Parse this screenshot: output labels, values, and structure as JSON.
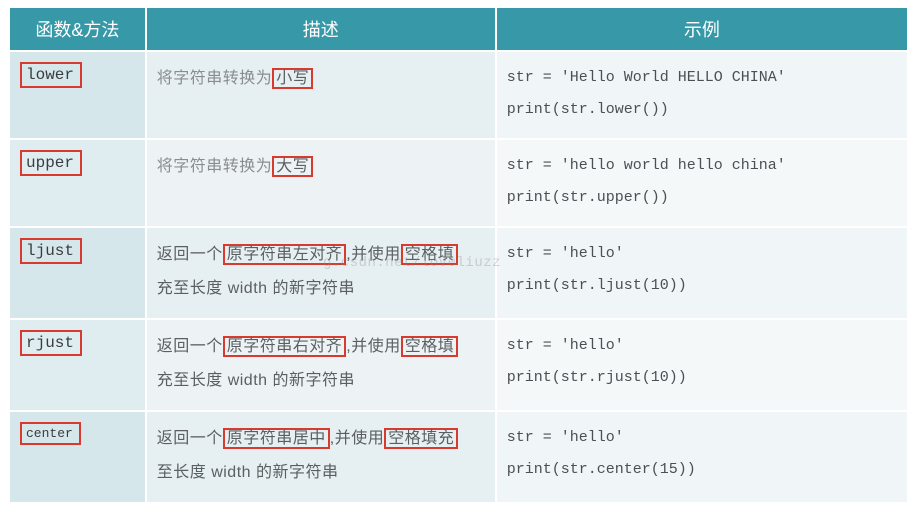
{
  "headers": {
    "col1": "函数&方法",
    "col2": "描述",
    "col3": "示例"
  },
  "rows": [
    {
      "fn": "lower",
      "fn_small": false,
      "desc_pre": "将字符串转换为",
      "desc_hl1": "小写",
      "desc_mid": "",
      "desc_hl2": "",
      "desc_post": "",
      "desc_line2": "",
      "desc_greyish": true,
      "ex1": "str = 'Hello World HELLO CHINA'",
      "ex2": "print(str.lower())"
    },
    {
      "fn": "upper",
      "fn_small": false,
      "desc_pre": "将字符串转换为",
      "desc_hl1": "大写",
      "desc_mid": "",
      "desc_hl2": "",
      "desc_post": "",
      "desc_line2": "",
      "desc_greyish": true,
      "ex1": "str = 'hello world hello china'",
      "ex2": "print(str.upper())"
    },
    {
      "fn": "ljust",
      "fn_small": false,
      "desc_pre": "返回一个",
      "desc_hl1": "原字符串左对齐",
      "desc_mid": ",并使用",
      "desc_hl2": "空格填",
      "desc_post": "",
      "desc_line2": "充至长度 width 的新字符串",
      "desc_greyish": false,
      "ex1": "str = 'hello'",
      "ex2": "print(str.ljust(10))"
    },
    {
      "fn": "rjust",
      "fn_small": false,
      "desc_pre": "返回一个",
      "desc_hl1": "原字符串右对齐",
      "desc_mid": ",并使用",
      "desc_hl2": "空格填",
      "desc_post": "",
      "desc_line2": "充至长度 width 的新字符串",
      "desc_greyish": false,
      "ex1": "str = 'hello'",
      "ex2": "print(str.rjust(10))"
    },
    {
      "fn": "center",
      "fn_small": true,
      "desc_pre": "返回一个",
      "desc_hl1": "原字符串居中",
      "desc_mid": ",并使用",
      "desc_hl2": "空格填充",
      "desc_post": "",
      "desc_line2": "至长度 width 的新字符串",
      "desc_greyish": false,
      "ex1": "str = 'hello'",
      "ex2": "print(str.center(15))"
    }
  ],
  "watermark": "g.csdn.net/loveliuzz"
}
